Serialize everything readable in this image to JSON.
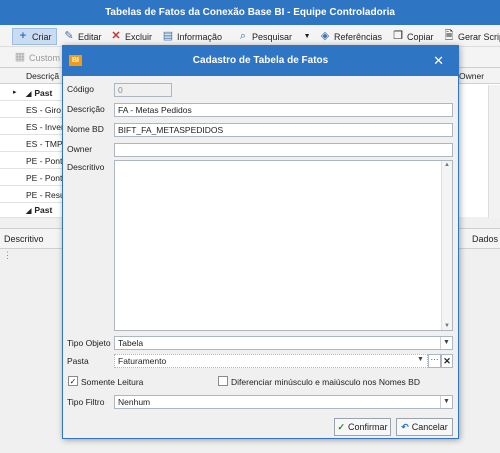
{
  "window": {
    "title": "Tabelas de Fatos da Conexão Base BI - Equipe Controladoria"
  },
  "toolbar": {
    "criar": "Criar",
    "editar": "Editar",
    "excluir": "Excluir",
    "informacao": "Informação",
    "pesquisar": "Pesquisar",
    "referencias": "Referências",
    "copiar": "Copiar",
    "gerar_script": "Gerar Scrip",
    "custom": "Custom"
  },
  "grid": {
    "col_descricao": "Descriçã",
    "col_owner": "Owner",
    "rows": [
      "Past",
      "ES - Giro",
      "ES - Inver",
      "ES - TMP",
      "PE - Pont",
      "PE - Pont",
      "PE - Resu",
      "Past"
    ]
  },
  "bottom_panel": {
    "descritivo_tab": "Descritivo",
    "dados_tab": "Dados"
  },
  "dialog": {
    "logo": "BI",
    "title": "Cadastro de Tabela de Fatos",
    "fields": {
      "codigo": {
        "label": "Código",
        "value": "0"
      },
      "descricao": {
        "label": "Descrição",
        "value": "FA - Metas Pedidos"
      },
      "nome_bd": {
        "label": "Nome BD",
        "value": "BIFT_FA_METASPEDIDOS"
      },
      "owner": {
        "label": "Owner",
        "value": ""
      },
      "descritivo": {
        "label": "Descritivo",
        "value": ""
      },
      "tipo_objeto": {
        "label": "Tipo Objeto",
        "value": "Tabela"
      },
      "pasta": {
        "label": "Pasta",
        "value": "Faturamento"
      },
      "tipo_filtro": {
        "label": "Tipo Filtro",
        "value": "Nenhum"
      }
    },
    "checkboxes": {
      "somente_leitura": {
        "label": "Somente Leitura",
        "checked": true
      },
      "diferenciar": {
        "label": "Diferenciar minúsculo e maiúsculo nos Nomes BD",
        "checked": false
      }
    },
    "buttons": {
      "confirmar": "Confirmar",
      "cancelar": "Cancelar"
    }
  },
  "colors": {
    "accent": "#2e75c4",
    "logo": "#f39c12",
    "success": "#2a8a2a",
    "danger": "#d03030"
  }
}
